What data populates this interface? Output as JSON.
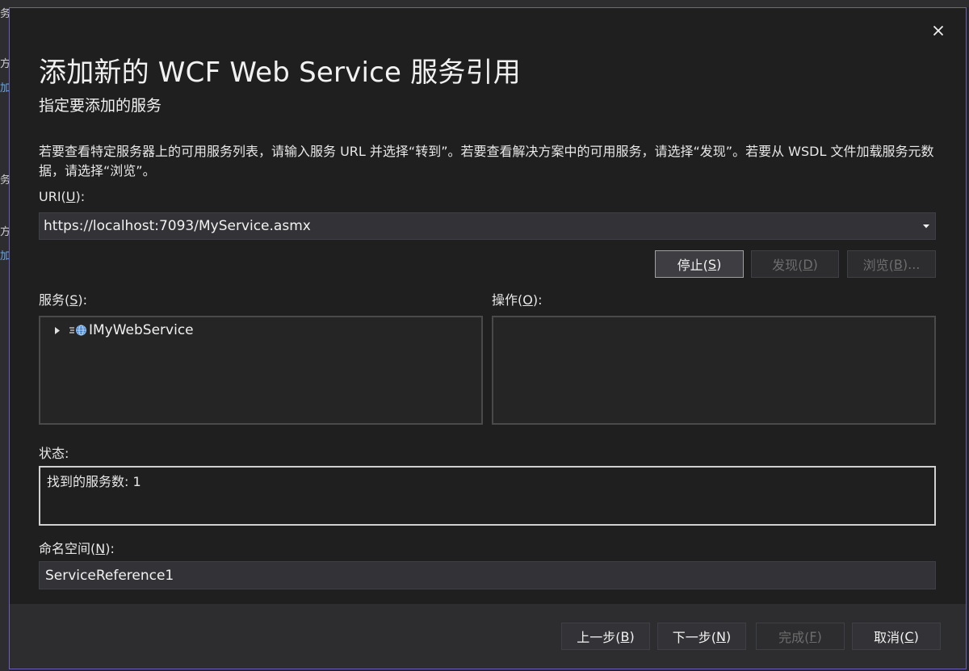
{
  "dialog": {
    "title": "添加新的 WCF Web Service 服务引用",
    "subtitle": "指定要添加的服务",
    "description": "若要查看特定服务器上的可用服务列表，请输入服务 URL 并选择“转到”。若要查看解决方案中的可用服务，请选择“发现”。若要从 WSDL 文件加载服务元数据，请选择“浏览”。",
    "close_icon": "close-icon"
  },
  "uri": {
    "label_prefix": "URI(",
    "label_key": "U",
    "label_suffix": "):",
    "value": "https://localhost:7093/MyService.asmx"
  },
  "uri_buttons": {
    "stop": {
      "prefix": "停止(",
      "key": "S",
      "suffix": ")"
    },
    "discover": {
      "prefix": "发现(",
      "key": "D",
      "suffix": ")"
    },
    "browse": {
      "prefix": "浏览(",
      "key": "B",
      "suffix": ")..."
    }
  },
  "services": {
    "label_prefix": "服务(",
    "label_key": "S",
    "label_suffix": "):",
    "items": [
      {
        "label": "IMyWebService",
        "icon": "web-service-icon",
        "expanded": false
      }
    ]
  },
  "operations": {
    "label_prefix": "操作(",
    "label_key": "O",
    "label_suffix": "):"
  },
  "status": {
    "label": "状态:",
    "text": "找到的服务数: 1"
  },
  "namespace": {
    "label_prefix": "命名空间(",
    "label_key": "N",
    "label_suffix": "):",
    "value": "ServiceReference1"
  },
  "footer_buttons": {
    "back": {
      "prefix": "上一步(",
      "key": "B",
      "suffix": ")"
    },
    "next": {
      "prefix": "下一步(",
      "key": "N",
      "suffix": ")"
    },
    "finish": {
      "prefix": "完成(",
      "key": "F",
      "suffix": ")"
    },
    "cancel": {
      "prefix": "取消(",
      "key": "C",
      "suffix": ")"
    }
  },
  "background": {
    "fragments": [
      "务",
      "方",
      "加",
      "务",
      "方",
      "加"
    ]
  },
  "colors": {
    "dialog_border": "#6b5fb8",
    "dialog_bg": "#1f1f1f",
    "footer_bg": "#2d2d30",
    "input_bg": "#333337",
    "link": "#6aa6e8"
  }
}
